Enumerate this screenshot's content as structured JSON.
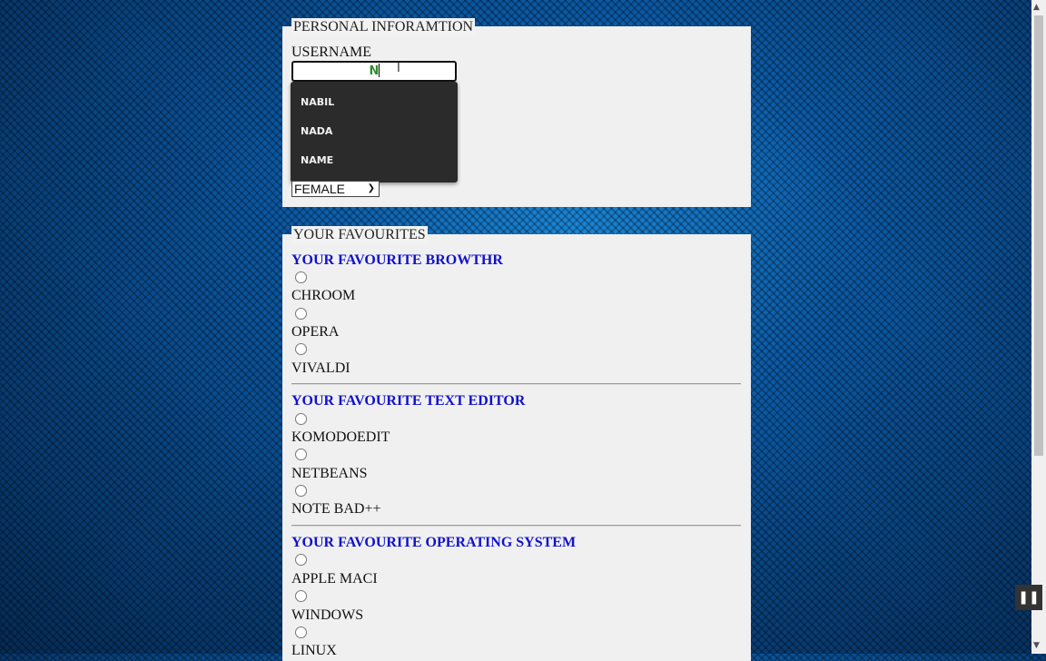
{
  "personal": {
    "legend": "PERSONAL INFORAMTION",
    "username_label": "USERNAME",
    "username_value": "N",
    "autocomplete": [
      "NABIL",
      "NADA",
      "NAME"
    ],
    "gender_selected": "FEMALE"
  },
  "favourites": {
    "legend": "YOUR FAVOURITES",
    "groups": [
      {
        "heading": "YOUR FAVOURITE BROWTHR",
        "options": [
          "CHROOM",
          "OPERA",
          "VIVALDI"
        ]
      },
      {
        "heading": "YOUR FAVOURITE TEXT EDITOR",
        "options": [
          "KOMODOEDIT",
          "NETBEANS",
          "NOTE BAD++"
        ]
      },
      {
        "heading": "YOUR FAVOURITE OPERATING SYSTEM",
        "options": [
          "APPLE MACI",
          "WINDOWS",
          "LINUX"
        ]
      }
    ]
  },
  "icons": {
    "pause": "pause-icon",
    "scroll_up": "chevron-up-icon",
    "scroll_down": "chevron-down-icon",
    "select_arrow": "chevron-down-icon"
  },
  "colors": {
    "heading": "#1111cc",
    "input_text": "#2a8f2a",
    "autocomplete_bg": "#2b2b2b"
  }
}
